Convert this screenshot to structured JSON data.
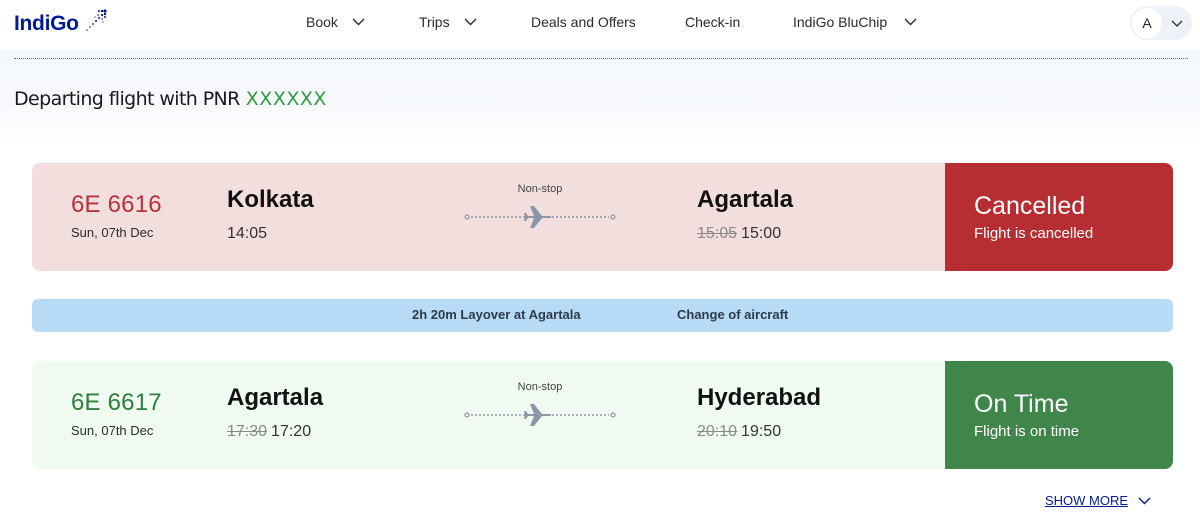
{
  "brand": {
    "name": "IndiGo"
  },
  "nav": {
    "items": [
      {
        "label": "Book",
        "has_dropdown": true
      },
      {
        "label": "Trips",
        "has_dropdown": true
      },
      {
        "label": "Deals and Offers",
        "has_dropdown": false
      },
      {
        "label": "Check-in",
        "has_dropdown": false
      },
      {
        "label": "IndiGo BluChip",
        "has_dropdown": true
      }
    ],
    "avatar_initial": "A"
  },
  "heading": {
    "text": "Departing flight with PNR",
    "pnr": "XXXXXX"
  },
  "flights": [
    {
      "flight_number": "6E 6616",
      "date": "Sun, 07th Dec",
      "origin": "Kolkata",
      "departure_time": "14:05",
      "departure_time_old": "",
      "stops": "Non-stop",
      "destination": "Agartala",
      "arrival_time_old": "15:05",
      "arrival_time": "15:00",
      "status": "Cancelled",
      "status_detail": "Flight is cancelled"
    },
    {
      "flight_number": "6E 6617",
      "date": "Sun, 07th Dec",
      "origin": "Agartala",
      "departure_time_old": "17:30",
      "departure_time": "17:20",
      "stops": "Non-stop",
      "destination": "Hyderabad",
      "arrival_time_old": "20:10",
      "arrival_time": "19:50",
      "status": "On Time",
      "status_detail": "Flight is on time"
    }
  ],
  "layover": {
    "duration_text": "2h 20m Layover at Agartala",
    "note": "Change of aircraft"
  },
  "show_more": "SHOW MORE",
  "colors": {
    "brand_blue": "#001b94",
    "cancelled": "#b62e32",
    "on_time": "#40864a",
    "cancelled_bg": "#f3dede",
    "on_time_bg": "#effbf1",
    "layover_bg": "#b7dbf7",
    "pnr_green": "#2e9e3c"
  }
}
